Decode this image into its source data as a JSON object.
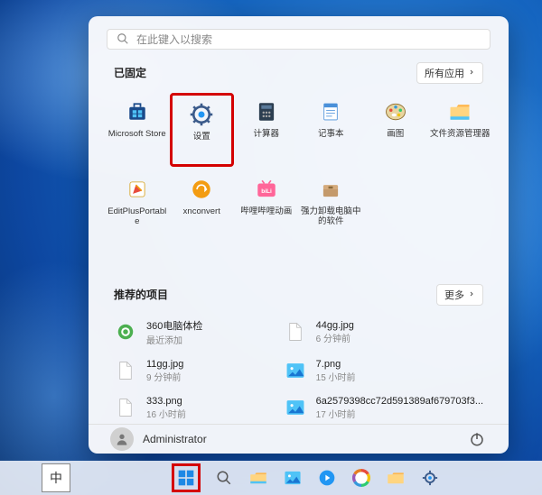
{
  "search": {
    "placeholder": "在此键入以搜索"
  },
  "pinned": {
    "title": "已固定",
    "all_apps_label": "所有应用",
    "items": [
      {
        "label": "Microsoft Store",
        "icon": "store-icon"
      },
      {
        "label": "设置",
        "icon": "settings-icon",
        "highlighted": true
      },
      {
        "label": "计算器",
        "icon": "calculator-icon"
      },
      {
        "label": "记事本",
        "icon": "notepad-icon"
      },
      {
        "label": "画图",
        "icon": "paint-icon"
      },
      {
        "label": "文件资源管理器",
        "icon": "explorer-icon"
      },
      {
        "label": "EditPlusPortable",
        "icon": "editplus-icon"
      },
      {
        "label": "xnconvert",
        "icon": "xnconvert-icon"
      },
      {
        "label": "哔哩哔哩动画",
        "icon": "bilibili-icon"
      },
      {
        "label": "强力卸载电脑中的软件",
        "icon": "uninstall-icon"
      }
    ]
  },
  "recommended": {
    "title": "推荐的项目",
    "more_label": "更多",
    "items": [
      {
        "name": "360电脑体检",
        "meta": "最近添加",
        "icon": "360-icon"
      },
      {
        "name": "44gg.jpg",
        "meta": "6 分钟前",
        "icon": "file-icon"
      },
      {
        "name": "11gg.jpg",
        "meta": "9 分钟前",
        "icon": "file-icon"
      },
      {
        "name": "7.png",
        "meta": "15 小时前",
        "icon": "image-icon"
      },
      {
        "name": "333.png",
        "meta": "16 小时前",
        "icon": "file-icon"
      },
      {
        "name": "6a2579398cc72d591389af679703f3...",
        "meta": "17 小时前",
        "icon": "image-icon"
      }
    ]
  },
  "footer": {
    "username": "Administrator"
  },
  "ime": {
    "label": "中"
  },
  "taskbar": {
    "items": [
      {
        "icon": "start-icon",
        "highlighted": true
      },
      {
        "icon": "search-tb-icon"
      },
      {
        "icon": "explorer-tb-icon"
      },
      {
        "icon": "photos-tb-icon"
      },
      {
        "icon": "circle-blue-icon"
      },
      {
        "icon": "circle-rainbow-icon"
      },
      {
        "icon": "folder-icon"
      },
      {
        "icon": "gear-icon"
      }
    ]
  }
}
